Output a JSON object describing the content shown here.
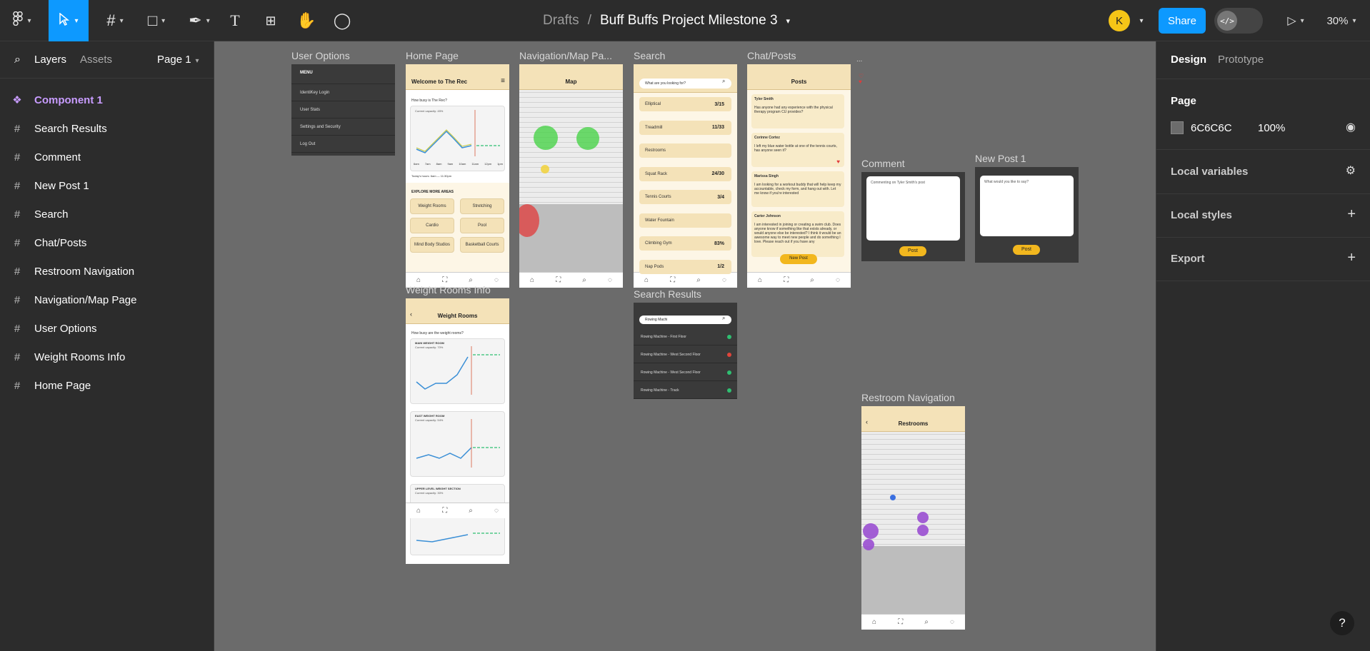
{
  "toolbar": {
    "main_menu_icon": "figma-logo-icon",
    "move_tool_icon": "pointer-icon",
    "frame_tool_icon": "frame-icon",
    "shape_tool_icon": "rectangle-icon",
    "pen_tool_icon": "pen-icon",
    "text_tool_icon": "text-icon",
    "resources_icon": "components-icon",
    "hand_tool_icon": "hand-icon",
    "comment_tool_icon": "comment-icon"
  },
  "header": {
    "breadcrumb_root": "Drafts",
    "breadcrumb_sep": "/",
    "file_name": "Buff Buffs Project Milestone 3",
    "avatar_initial": "K",
    "share_label": "Share",
    "zoom": "30%",
    "dev_mode_glyph": "</>"
  },
  "left_panel": {
    "tabs": [
      "Layers",
      "Assets"
    ],
    "page_selector": "Page 1",
    "layers": [
      {
        "label": "Component 1",
        "type": "component"
      },
      {
        "label": "Search Results",
        "type": "frame"
      },
      {
        "label": "Comment",
        "type": "frame"
      },
      {
        "label": "New Post 1",
        "type": "frame"
      },
      {
        "label": "Search",
        "type": "frame"
      },
      {
        "label": "Chat/Posts",
        "type": "frame"
      },
      {
        "label": "Restroom Navigation",
        "type": "frame"
      },
      {
        "label": "Navigation/Map Page",
        "type": "frame"
      },
      {
        "label": "User Options",
        "type": "frame"
      },
      {
        "label": "Weight Rooms Info",
        "type": "frame"
      },
      {
        "label": "Home Page",
        "type": "frame"
      }
    ]
  },
  "right_panel": {
    "tabs": [
      "Design",
      "Prototype"
    ],
    "page_section": "Page",
    "page_color": "6C6C6C",
    "page_opacity": "100%",
    "page_swatch": "#6c6c6c",
    "local_variables": "Local variables",
    "local_styles": "Local styles",
    "export": "Export"
  },
  "canvas": {
    "frames": {
      "user_options": {
        "label": "User Options",
        "menu_title": "MENU",
        "items": [
          "IdentiKey Login",
          "User Stats",
          "Settings and Security",
          "Log Out"
        ]
      },
      "home": {
        "label": "Home Page",
        "title": "Welcome to The Rec",
        "busy_q": "How busy is The Rec?",
        "capacity": "Current capacity: 45%",
        "hours": "Today's hours: 6am — 11:30pm",
        "explore": "EXPLORE MORE AREAS",
        "areas": [
          "Weight Rooms",
          "Stretching",
          "Cardio",
          "Pool",
          "Mind Body Studios",
          "Basketball Courts"
        ],
        "xticks": [
          "6am",
          "7am",
          "8am",
          "9am",
          "10am",
          "11am",
          "12pm",
          "1pm"
        ]
      },
      "map": {
        "label": "Navigation/Map Pa...",
        "title": "Map"
      },
      "search": {
        "label": "Search",
        "placeholder": "What are you looking for?",
        "rows": [
          {
            "name": "Elliptical",
            "count": "3/15"
          },
          {
            "name": "Treadmill",
            "count": "11/33"
          },
          {
            "name": "Restrooms",
            "count": ""
          },
          {
            "name": "Squat Rack",
            "count": "24/30"
          },
          {
            "name": "Tennis Courts",
            "count": "3/4"
          },
          {
            "name": "Water Fountain",
            "count": ""
          },
          {
            "name": "Climbing Gym",
            "count": "83%"
          },
          {
            "name": "Nap Pods",
            "count": "1/2"
          }
        ]
      },
      "chat": {
        "label": "Chat/Posts",
        "title": "Posts",
        "posts": [
          {
            "author": "Tyler Smith",
            "text": "Has anyone had any experience with the physical therapy program CU provides?"
          },
          {
            "author": "Corinne Cortez",
            "text": "I left my blue water bottle at one of the tennis courts, has anyone seen it?"
          },
          {
            "author": "Marissa Singh",
            "text": "I am looking for a workout buddy that will help keep my accountable, check my form, and hang out with. Let me know if you're interested"
          },
          {
            "author": "Carter Johnson",
            "text": "I am interested in joining or creating a swim club. Does anyone know if something like that exists already, or would anyone else be interested? I think it would be an awesome way to meet new people and do something I love. Please reach out if you have any"
          }
        ],
        "new_post": "New Post",
        "ellipsis": "..."
      },
      "comment": {
        "label": "Comment",
        "placeholder": "Commenting on Tyler Smith's post",
        "button": "Post"
      },
      "new_post": {
        "label": "New Post 1",
        "placeholder": "What would you like to say?",
        "button": "Post"
      },
      "weight": {
        "label": "Weight Rooms Info",
        "title": "Weight Rooms",
        "q": "How busy are the weight rooms?",
        "sections": [
          {
            "name": "MAIN WEIGHT ROOM",
            "capacity": "Current capacity: 70%"
          },
          {
            "name": "EAST WEIGHT ROOM",
            "capacity": "Current capacity: 54%"
          },
          {
            "name": "UPPER LEVEL WEIGHT SECTION",
            "capacity": "Current capacity: 30%"
          }
        ]
      },
      "search_results": {
        "label": "Search Results",
        "query": "Rowing Machi",
        "rows": [
          {
            "name": "Rowing Machine - First Floor",
            "status_color": "#2fbf71"
          },
          {
            "name": "Rowing Machine - West Second Floor",
            "status_color": "#e0453b"
          },
          {
            "name": "Rowing Machine - West Second Floor",
            "status_color": "#2fbf71"
          },
          {
            "name": "Rowing Machine - Track",
            "status_color": "#2fbf71"
          }
        ]
      },
      "restroom": {
        "label": "Restroom Navigation",
        "title": "Restrooms"
      }
    }
  },
  "help_label": "?"
}
